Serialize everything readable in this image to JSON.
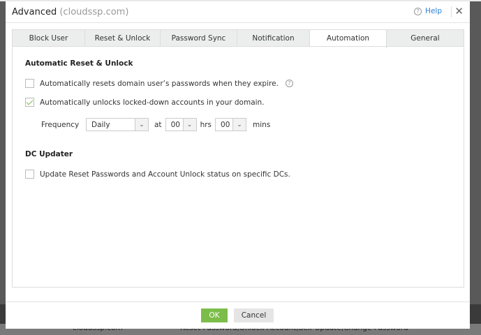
{
  "dialog": {
    "title": "Advanced",
    "domain": "(cloudssp.com)",
    "help_label": "Help"
  },
  "tabs": [
    {
      "label": "Block User"
    },
    {
      "label": "Reset & Unlock"
    },
    {
      "label": "Password Sync"
    },
    {
      "label": "Notification"
    },
    {
      "label": "Automation",
      "active": true
    },
    {
      "label": "General"
    }
  ],
  "automatic": {
    "heading": "Automatic Reset & Unlock",
    "option1": {
      "label": "Automatically resets domain user’s passwords when they expire.",
      "checked": false
    },
    "option2": {
      "label": "Automatically unlocks locked-down accounts in your domain.",
      "checked": true
    },
    "frequency_label": "Frequency",
    "frequency_value": "Daily",
    "at_label": "at",
    "hours_value": "00",
    "hrs_label": "hrs",
    "mins_value": "00",
    "mins_label": "mins"
  },
  "dc_updater": {
    "heading": "DC Updater",
    "option": {
      "label": "Update Reset Passwords and Account Unlock status on specific DCs.",
      "checked": false
    }
  },
  "buttons": {
    "ok": "OK",
    "cancel": "Cancel"
  },
  "background": {
    "domain": "cloudssp.com",
    "actions": "Reset Password,Unlock Account,Self Update,Change Password"
  },
  "colors": {
    "accent": "#7cbd4a",
    "link": "#2a7fd4"
  }
}
